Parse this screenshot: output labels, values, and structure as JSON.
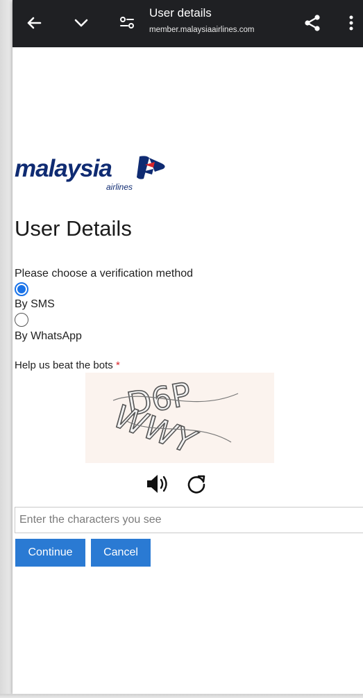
{
  "topbar": {
    "title": "User details",
    "url": "member.malaysiaairlines.com"
  },
  "brand": {
    "name": "malaysia",
    "sub": "airlines",
    "color": "#0f2b72"
  },
  "page": {
    "title": "User Details",
    "verification_prompt": "Please choose a verification method",
    "options": [
      {
        "label": "By SMS",
        "selected": true
      },
      {
        "label": "By WhatsApp",
        "selected": false
      }
    ],
    "captcha_label": "Help us beat the bots",
    "captcha_required_mark": "*",
    "captcha_characters": "D6PWWY",
    "captcha_input_placeholder": "Enter the characters you see",
    "continue_label": "Continue",
    "cancel_label": "Cancel"
  },
  "icons": {
    "back": "arrow-left-icon",
    "collapse": "chevron-down-icon",
    "page_controls": "tune-icon",
    "share": "share-icon",
    "menu": "more-vertical-icon",
    "audio": "speaker-icon",
    "reload": "refresh-icon"
  },
  "colors": {
    "topbar_bg": "#1f2023",
    "button_bg": "#2a7ad3",
    "radio_accent": "#1a73e8",
    "required": "#d9262b"
  }
}
